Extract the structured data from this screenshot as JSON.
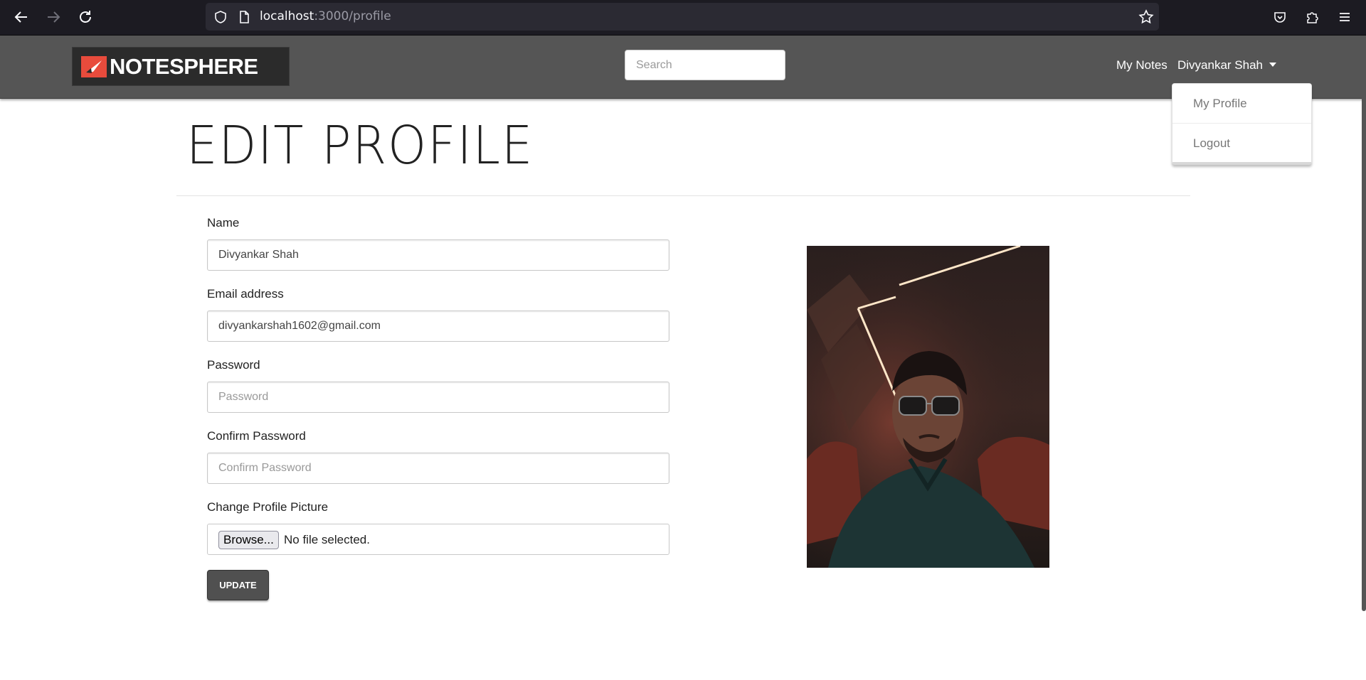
{
  "browser": {
    "url_host": "localhost",
    "url_path": ":3000/profile"
  },
  "navbar": {
    "brand": "NOTESPHERE",
    "search_placeholder": "Search",
    "my_notes": "My Notes",
    "user_name": "Divyankar Shah",
    "dropdown": {
      "my_profile": "My Profile",
      "logout": "Logout"
    }
  },
  "page": {
    "title": "EDIT PROFILE"
  },
  "form": {
    "name_label": "Name",
    "name_value": "Divyankar Shah",
    "email_label": "Email address",
    "email_value": "divyankarshah1602@gmail.com",
    "password_label": "Password",
    "password_placeholder": "Password",
    "confirm_label": "Confirm Password",
    "confirm_placeholder": "Confirm Password",
    "picture_label": "Change Profile Picture",
    "browse_label": "Browse...",
    "file_status": "No file selected.",
    "update_label": "UPDATE"
  },
  "colors": {
    "navbar_bg": "#555555",
    "brand_accent": "#e84b3c",
    "button_bg": "#505050"
  }
}
